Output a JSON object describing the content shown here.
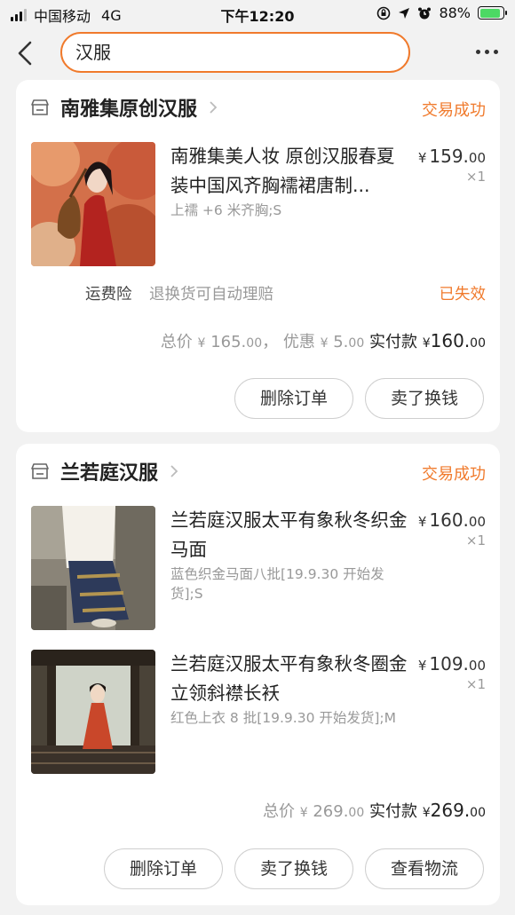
{
  "status_bar": {
    "carrier": "中国移动",
    "network": "4G",
    "time": "下午12:20",
    "battery": "88%",
    "battery_level": 0.88
  },
  "nav": {
    "search_value": "汉服"
  },
  "orders": [
    {
      "shop_name": "南雅集原创汉服",
      "status": "交易成功",
      "items": [
        {
          "title": "南雅集美人妆 原创汉服春夏装中国风齐胸襦裙唐制...",
          "sku": "上襦 +6 米齐胸;S",
          "price_currency": "¥",
          "price_int": "159.",
          "price_dec": "00",
          "qty": "×1"
        }
      ],
      "insurance": {
        "label": "运费险",
        "desc": "退换货可自动理赔",
        "state": "已失效"
      },
      "summary": {
        "total_label": "总价",
        "total_cur": "¥",
        "total_int": "165.",
        "total_dec": "00",
        "sep": "，",
        "discount_label": "优惠",
        "discount_cur": "¥",
        "discount_int": "5.",
        "discount_dec": "00",
        "paid_label": "实付款",
        "paid_cur": "¥",
        "paid_int": "160.",
        "paid_dec": "00"
      },
      "buttons": [
        "删除订单",
        "卖了换钱"
      ]
    },
    {
      "shop_name": "兰若庭汉服",
      "status": "交易成功",
      "items": [
        {
          "title": "兰若庭汉服太平有象秋冬织金马面",
          "sku": "蓝色织金马面八批[19.9.30 开始发货];S",
          "price_currency": "¥",
          "price_int": "160.",
          "price_dec": "00",
          "qty": "×1"
        },
        {
          "title": "兰若庭汉服太平有象秋冬圈金立领斜襟长袄",
          "sku": "红色上衣 8 批[19.9.30 开始发货];M",
          "price_currency": "¥",
          "price_int": "109.",
          "price_dec": "00",
          "qty": "×1"
        }
      ],
      "summary": {
        "total_label": "总价",
        "total_cur": "¥",
        "total_int": "269.",
        "total_dec": "00",
        "paid_label": "实付款",
        "paid_cur": "¥",
        "paid_int": "269.",
        "paid_dec": "00"
      },
      "buttons": [
        "删除订单",
        "卖了换钱",
        "查看物流"
      ]
    }
  ],
  "colors": {
    "accent": "#f07a2c",
    "muted": "#999999",
    "background": "#f2f2f2"
  },
  "icons": [
    "signal-icon",
    "lock-rotation-icon",
    "location-arrow-icon",
    "alarm-icon",
    "battery-icon",
    "back-chevron-icon",
    "more-dots-icon",
    "store-icon",
    "chevron-right-icon"
  ]
}
